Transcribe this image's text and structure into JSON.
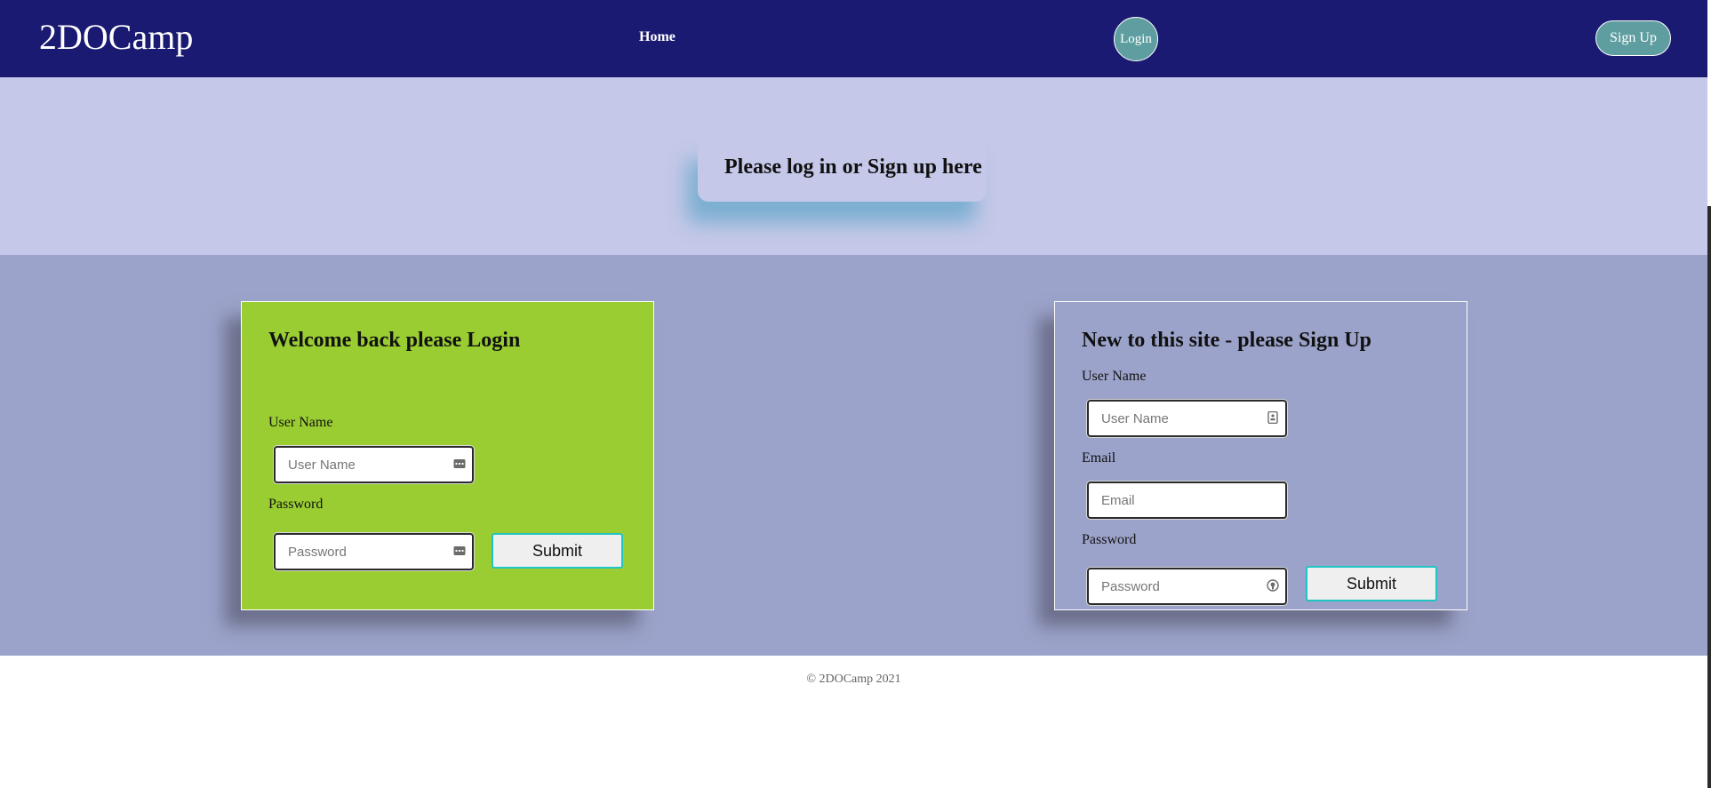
{
  "nav": {
    "brand": "2DOCamp",
    "home": "Home",
    "login": "Login",
    "signup": "Sign Up",
    "background": "#1a1a72",
    "button_color": "#5f9ea0"
  },
  "hero": {
    "title": "Please log in or Sign up here",
    "background": "#c5c8e8"
  },
  "login_form": {
    "title": "Welcome back please Login",
    "username_label": "User Name",
    "username_placeholder": "User Name",
    "password_label": "Password",
    "password_placeholder": "Password",
    "submit": "Submit",
    "background": "#9acd32"
  },
  "signup_form": {
    "title": "New to this site - please Sign Up",
    "username_label": "User Name",
    "username_placeholder": "User Name",
    "email_label": "Email",
    "email_placeholder": "Email",
    "password_label": "Password",
    "password_placeholder": "Password",
    "submit": "Submit",
    "background": "#9ca3ca"
  },
  "footer": {
    "text": "© 2DOCamp 2021"
  },
  "icons": {
    "login_username": "autofill-key-icon",
    "login_password": "autofill-key-icon",
    "signup_username": "contact-card-icon",
    "signup_password": "password-manager-icon"
  }
}
